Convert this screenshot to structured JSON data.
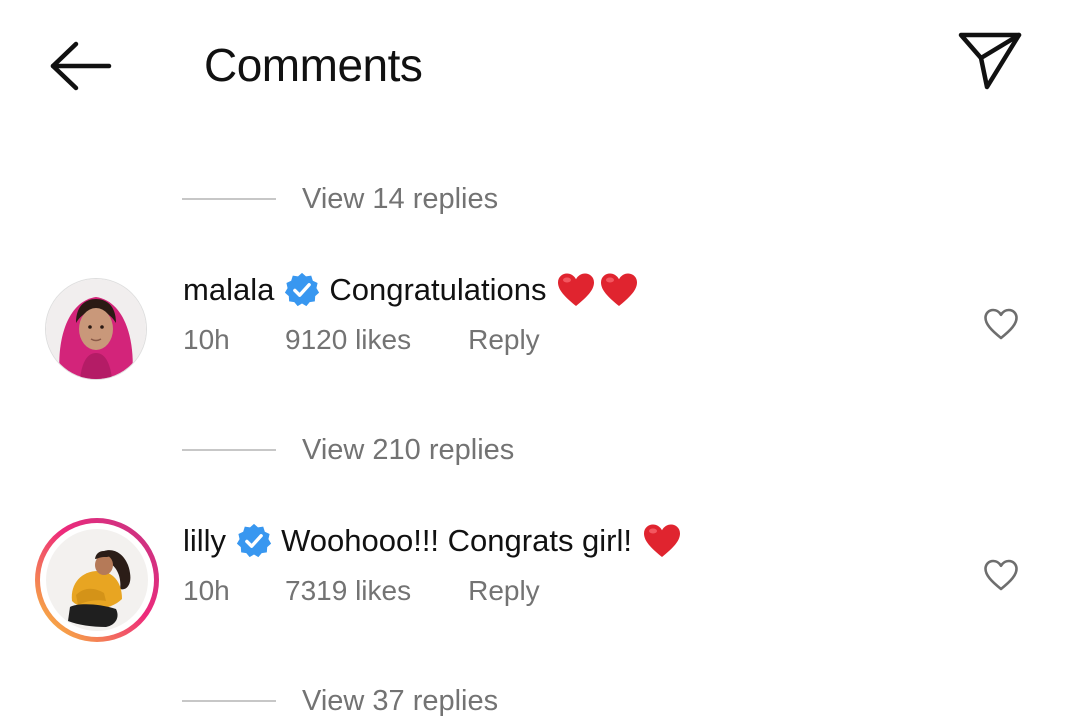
{
  "header": {
    "title": "Comments",
    "back_icon": "arrow-left-icon",
    "share_icon": "paper-plane-icon"
  },
  "view_replies": [
    {
      "label": "View 14 replies"
    },
    {
      "label": "View 210 replies"
    },
    {
      "label": "View 37 replies"
    }
  ],
  "comments": [
    {
      "username": "malala",
      "verified": true,
      "text": "Congratulations",
      "emojis": [
        "red-heart",
        "red-heart"
      ],
      "time": "10h",
      "likes": "9120 likes",
      "reply_label": "Reply",
      "story_ring": false
    },
    {
      "username": "lilly",
      "verified": true,
      "text": "Woohooo!!! Congrats girl!",
      "emojis": [
        "red-heart"
      ],
      "time": "10h",
      "likes": "7319 likes",
      "reply_label": "Reply",
      "story_ring": true
    }
  ],
  "colors": {
    "verified_blue": "#3897f0",
    "heart_red": "#e0242f",
    "muted_text": "#737373",
    "story_ring_start": "#f9ce34",
    "story_ring_end": "#c13584"
  }
}
